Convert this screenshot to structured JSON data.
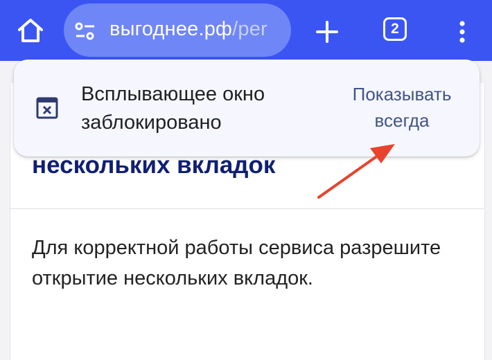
{
  "browser": {
    "url_domain": "выгоднее.рф",
    "url_path": "/per",
    "tab_count": "2",
    "icons": {
      "home": "home-icon",
      "site_settings": "tune-icon",
      "new_tab": "plus-icon",
      "tabs": "tab-switcher-icon",
      "menu": "more-vert-icon"
    }
  },
  "page": {
    "heading": "нескольких вкладок",
    "body": "Для корректной работы сервиса разрешите открытие нескольких вкладок."
  },
  "popup_blocked": {
    "message": "Всплывающее окно заблокировано",
    "action": "Показывать всегда",
    "icon": "popup-blocked-icon"
  },
  "annotation": {
    "icon": "red-arrow-icon",
    "color": "#e8432e"
  },
  "colors": {
    "toolbar": "#3b55f2",
    "omnibox": "#6f86f6",
    "heading": "#0f1f73",
    "action": "#40548a"
  }
}
